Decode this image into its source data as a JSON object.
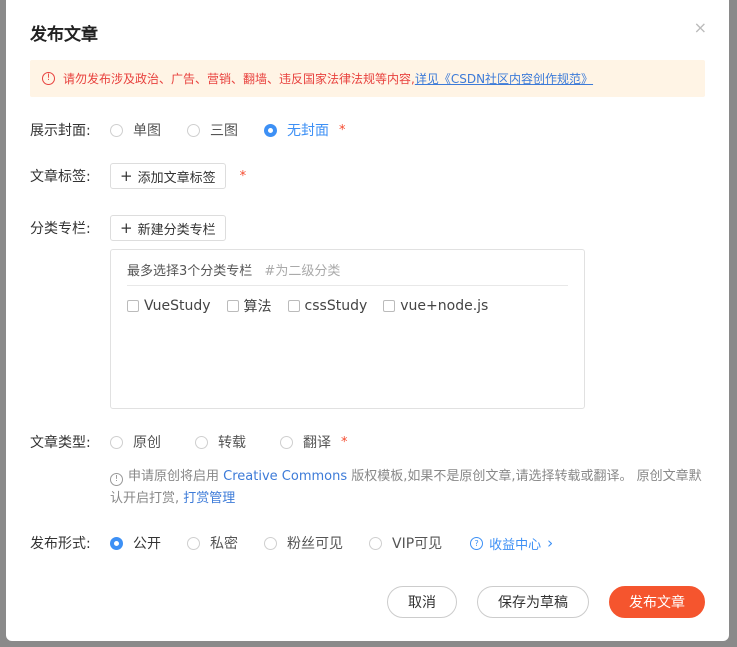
{
  "dialog": {
    "title": "发布文章",
    "close": "×"
  },
  "notice": {
    "text": "请勿发布涉及政治、广告、营销、翻墙、违反国家法律法规等内容,",
    "link": "详见《CSDN社区内容创作规范》"
  },
  "cover": {
    "label": "展示封面:",
    "options": [
      "单图",
      "三图",
      "无封面"
    ],
    "selected": "无封面",
    "required": "*"
  },
  "tags": {
    "label": "文章标签:",
    "button": "添加文章标签",
    "required": "*"
  },
  "column": {
    "label": "分类专栏:",
    "button": "新建分类专栏",
    "hint": "最多选择3个分类专栏",
    "hint_sub": "#为二级分类",
    "items": [
      "VueStudy",
      "算法",
      "cssStudy",
      "vue+node.js"
    ]
  },
  "article_type": {
    "label": "文章类型:",
    "options": [
      "原创",
      "转载",
      "翻译"
    ],
    "required": "*",
    "info_pre": "申请原创将启用",
    "info_link1": "Creative Commons",
    "info_mid": "版权模板,如果不是原创文章,请选择转载或翻译。 原创文章默认开启打赏,",
    "info_link2": "打赏管理"
  },
  "publish": {
    "label": "发布形式:",
    "options": [
      "公开",
      "私密",
      "粉丝可见",
      "VIP可见"
    ],
    "selected": "公开",
    "income": "收益中心",
    "income_arrow": "›"
  },
  "footer": {
    "cancel": "取消",
    "draft": "保存为草稿",
    "publish": "发布文章"
  },
  "colors": {
    "accent": "#f5552e",
    "link": "#3d90f5",
    "notice_bg": "#fff4e5"
  },
  "icons": [
    "warning-icon",
    "close-icon",
    "plus-icon",
    "info-icon",
    "question-icon",
    "chevron-right-icon"
  ]
}
